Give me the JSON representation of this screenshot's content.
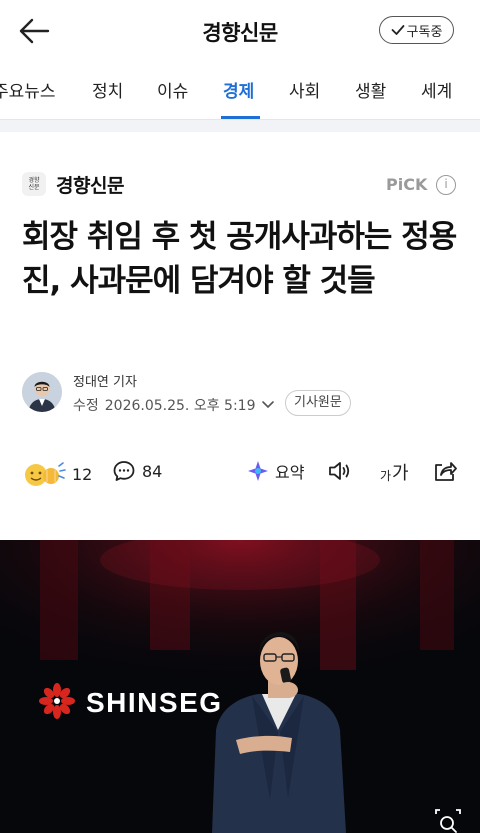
{
  "header": {
    "title": "경향신문",
    "subscribe_label": "구독중"
  },
  "nav": {
    "items": [
      {
        "label": "주요뉴스"
      },
      {
        "label": "정치"
      },
      {
        "label": "이슈"
      },
      {
        "label": "경제"
      },
      {
        "label": "사회"
      },
      {
        "label": "생활"
      },
      {
        "label": "세계"
      }
    ],
    "active_index": 3
  },
  "article": {
    "press_name": "경향신문",
    "press_logo_text": "경향신문",
    "pick_label": "PiCK",
    "headline": "회장 취임 후 첫 공개사과하는 정용진, 사과문에 담겨야 할 것들",
    "author": "정대연 기자",
    "modified_label": "수정",
    "date": "2026.05.25. 오후 5:19",
    "original_label": "기사원문"
  },
  "actions": {
    "reaction_count": "12",
    "comment_count": "84",
    "summary_label": "요약",
    "font_label_small": "가",
    "font_label_large": "가"
  },
  "photo": {
    "brand_text": "SHINSEG"
  },
  "colors": {
    "accent": "#1f6fd6",
    "muted": "#9a9a9a"
  }
}
